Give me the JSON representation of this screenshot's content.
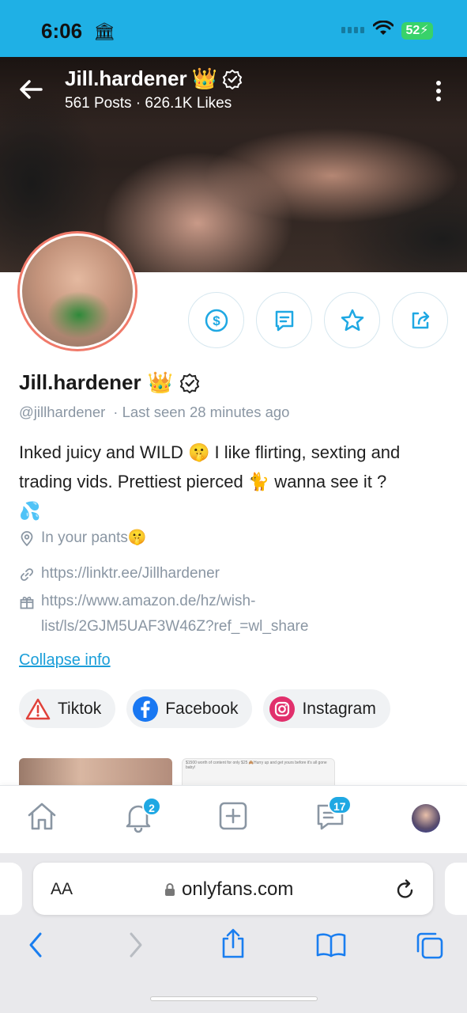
{
  "status_bar": {
    "time": "6:06",
    "battery": "52"
  },
  "header": {
    "name": "Jill.hardener",
    "stats": "561 Posts  ·  626.1K Likes",
    "crown": "👑"
  },
  "profile": {
    "name": "Jill.hardener",
    "crown": "👑",
    "handle": "@jillhardener",
    "last_seen": "· Last seen 28 minutes ago",
    "bio_lines": [
      "Inked juicy and WILD 🤫 I like flirting, sexting and",
      "trading vids. Prettiest pierced 🐈 wanna see it ?",
      "💦"
    ],
    "location": "In your pants🤫",
    "link": "https://linktr.ee/Jillhardener",
    "wishlist_line1": "https://www.amazon.de/hz/wish-",
    "wishlist_line2": "list/ls/2GJM5UAF3W46Z?ref_=wl_share",
    "collapse_label": "Collapse info"
  },
  "socials": [
    {
      "label": "Tiktok",
      "icon": "warning-icon",
      "color": "#e0413a"
    },
    {
      "label": "Facebook",
      "icon": "facebook-icon",
      "color": "#1877f2"
    },
    {
      "label": "Instagram",
      "icon": "instagram-icon",
      "color": "#e1306c"
    }
  ],
  "preview": {
    "promo_text": "$1500 worth of content for only $25 🙈Hurry up and get yours before it's all gone baby!"
  },
  "bottom_nav": {
    "notifications_badge": "2",
    "messages_badge": "17"
  },
  "browser": {
    "text_size_label": "AA",
    "url": "onlyfans.com"
  },
  "colors": {
    "brand": "#1fa8e3",
    "status_bar": "#1fb0e5",
    "battery": "#38d26a",
    "avatar_ring": "#f07a6a"
  }
}
